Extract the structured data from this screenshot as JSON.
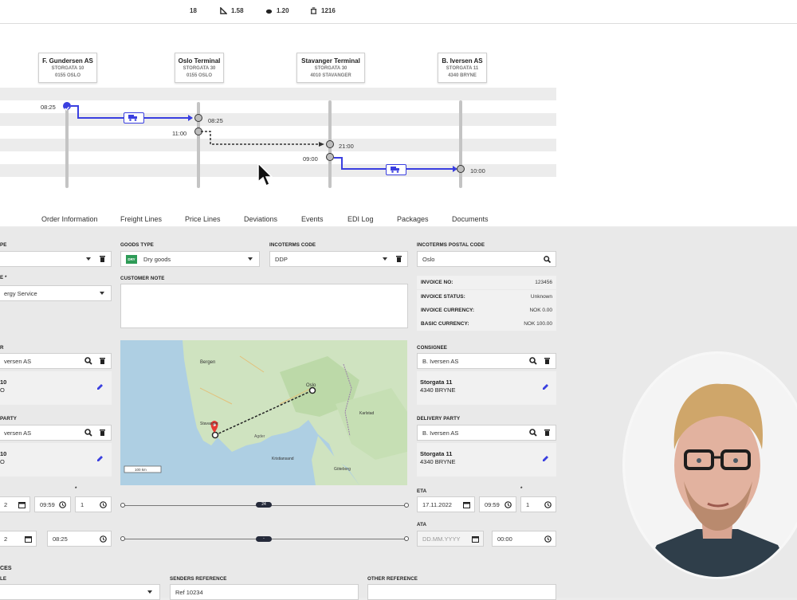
{
  "stats": [
    {
      "icon": "count-icon",
      "value": "18"
    },
    {
      "icon": "ruler-icon",
      "value": "1.58"
    },
    {
      "icon": "weight-icon",
      "value": "1.20"
    },
    {
      "icon": "pallet-icon",
      "value": "1216"
    }
  ],
  "route": {
    "parties": [
      {
        "name": "F. Gundersen AS",
        "line1": "STORGATA 10",
        "line2": "0155 OSLO"
      },
      {
        "name": "Oslo Terminal",
        "line1": "STORGATA 30",
        "line2": "0155 OSLO"
      },
      {
        "name": "Stavanger Terminal",
        "line1": "STORGATA 30",
        "line2": "4010 STAVANGER"
      },
      {
        "name": "B. Iversen AS",
        "line1": "STORGATA 11",
        "line2": "4340 BRYNE"
      }
    ],
    "times": {
      "t1_depart": "08:25",
      "t1_arrive": "08:25",
      "t2_depart": "11:00",
      "t2_arrive": "21:00",
      "t3_depart": "09:00",
      "t3_arrive": "10:00"
    }
  },
  "tabs": [
    "Order Information",
    "Freight Lines",
    "Price Lines",
    "Deviations",
    "Events",
    "EDI Log",
    "Packages",
    "Documents"
  ],
  "form": {
    "col1": {
      "label_type": "PE",
      "label_service": "E *",
      "service_value": "ergy Service",
      "label_sender": "R",
      "sender_value": "versen AS",
      "sender_addr1": "10",
      "sender_addr2": "O",
      "label_pickup": "PARTY",
      "pickup_value": "versen AS",
      "pickup_addr1": "10",
      "pickup_addr2": "O",
      "etd_date": "2",
      "etd_time": "09:59",
      "etd_qty": "1",
      "atd_time": "08:25",
      "label_references": "CES",
      "label_reference_type": "LE"
    },
    "goods_type": {
      "label": "GOODS TYPE",
      "badge": "DRY",
      "value": "Dry goods"
    },
    "customer_note": {
      "label": "CUSTOMER NOTE"
    },
    "incoterms": {
      "label": "INCOTERMS CODE",
      "value": "DDP"
    },
    "incoterms_postal": {
      "label": "INCOTERMS POSTAL CODE",
      "value": "Oslo"
    },
    "invoice": [
      {
        "k": "INVOICE NO:",
        "v": "123456"
      },
      {
        "k": "INVOICE STATUS:",
        "v": "Unknown"
      },
      {
        "k": "INVOICE CURRENCY:",
        "v": "NOK 0.00"
      },
      {
        "k": "BASIC CURRENCY:",
        "v": "NOK 100.00"
      }
    ],
    "consignee": {
      "label": "CONSIGNEE",
      "value": "B. Iversen AS",
      "addr1": "Storgata 11",
      "addr2": "4340 BRYNE"
    },
    "delivery_party": {
      "label": "DELIVERY PARTY",
      "value": "B. Iversen AS",
      "addr1": "Storgata 11",
      "addr2": "4340 BRYNE"
    },
    "eta": {
      "label": "ETA",
      "date": "17.11.2022",
      "time": "09:59",
      "star": "*",
      "qty": "1"
    },
    "ata": {
      "label": "ATA",
      "date_placeholder": "DD.MM.YYYY",
      "time": "00:00"
    },
    "slider1_label": "24",
    "slider2_label": "-",
    "senders_reference": {
      "label": "SENDERS REFERENCE",
      "value": "Ref 10234"
    },
    "other_reference": {
      "label": "OTHER REFERENCE"
    },
    "star": "*"
  },
  "map": {
    "cities": [
      "Bergen",
      "Oslo",
      "Karlstad",
      "Stavanger",
      "Kristiansand",
      "Göteborg",
      "Agder"
    ],
    "scale": "100 km"
  },
  "colors": {
    "accent": "#3a3fe0",
    "dark": "#252a3a"
  }
}
